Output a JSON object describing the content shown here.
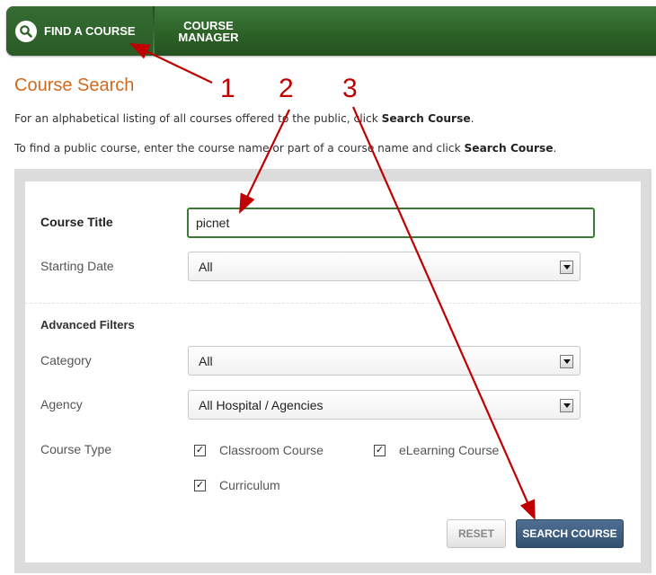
{
  "nav": {
    "find_label": "FIND A COURSE",
    "manager_label": "COURSE\nMANAGER"
  },
  "page": {
    "title": "Course Search",
    "intro1_text": "For an alphabetical listing of all courses offered to the public, click ",
    "intro1_bold": "Search Course",
    "intro1_end": ".",
    "intro2_text": "To find a public course, enter the course name or part of a course name and click ",
    "intro2_bold": "Search Course",
    "intro2_end": "."
  },
  "form": {
    "course_title_label": "Course Title",
    "course_title_value": "picnet",
    "starting_date_label": "Starting Date",
    "starting_date_value": "All",
    "advanced_filters_label": "Advanced Filters",
    "category_label": "Category",
    "category_value": "All",
    "agency_label": "Agency",
    "agency_value": "All Hospital / Agencies",
    "course_type_label": "Course Type",
    "course_types": [
      {
        "label": "Classroom Course",
        "checked": true
      },
      {
        "label": "eLearning Course",
        "checked": true
      },
      {
        "label": "Curriculum",
        "checked": true
      }
    ],
    "reset_label": "RESET",
    "search_label": "SEARCH COURSE"
  },
  "annotations": {
    "color": "#c00000",
    "markers": [
      "1",
      "2",
      "3"
    ]
  },
  "colors": {
    "nav_green": "#2d6227",
    "title_orange": "#d06a1e",
    "search_button": "#3f5e80"
  }
}
